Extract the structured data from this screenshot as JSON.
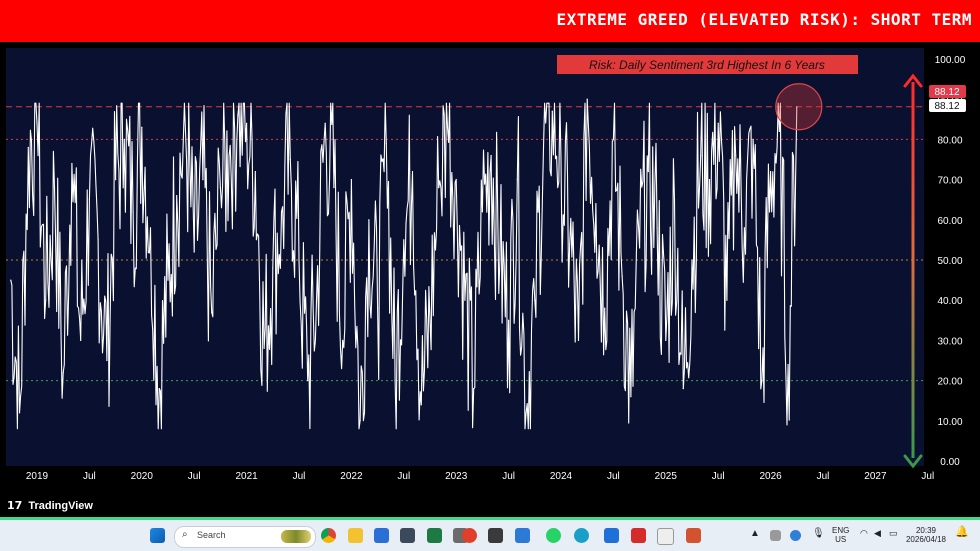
{
  "banner": {
    "title": "EXTREME GREED (ELEVATED RISK): SHORT TERM"
  },
  "annotation": {
    "text": "Risk: Daily Sentiment 3rd Highest In 6 Years"
  },
  "price_labels": {
    "current": "88.12",
    "reference": "88.12"
  },
  "branding": {
    "logo_text": "TradingView",
    "logo_mark": "17"
  },
  "taskbar": {
    "search_placeholder": "Search",
    "language": "ENG",
    "region": "US",
    "time": "20:39",
    "date": "2026/04/18"
  },
  "colors": {
    "banner": "#ff0000",
    "plot_background": "#0a1030",
    "series": "#ffffff",
    "high_dash": "#e03a3a",
    "mid_line": "#c0822a",
    "low_line": "#3f9f55",
    "arrow_top": "#ff2a2a",
    "arrow_bottom": "#3a9a4a"
  },
  "chart_data": {
    "type": "line",
    "title": "",
    "xlabel": "",
    "ylabel": "",
    "ylim": [
      0,
      100
    ],
    "y_ticks": [
      "100.00",
      "90.00",
      "80.00",
      "70.00",
      "60.00",
      "50.00",
      "40.00",
      "30.00",
      "20.00",
      "10.00",
      "0.00"
    ],
    "x_ticks": [
      "2019",
      "Jul",
      "2020",
      "Jul",
      "2021",
      "Jul",
      "2022",
      "Jul",
      "2023",
      "Jul",
      "2024",
      "Jul",
      "2025",
      "Jul",
      "2026",
      "Jul",
      "2027",
      "Jul"
    ],
    "reference_lines": [
      88.12,
      80,
      50,
      20
    ],
    "last_value": 88.12,
    "highlight": {
      "date": "2026-04-18",
      "value": 88.12
    },
    "series": [
      {
        "x": [
          "2018-10",
          "2018-11",
          "2018-12",
          "2019-01",
          "2019-02",
          "2019-03",
          "2019-04",
          "2019-05",
          "2019-06",
          "2019-07",
          "2019-08",
          "2019-09",
          "2019-10",
          "2019-11",
          "2019-12",
          "2020-01",
          "2020-02",
          "2020-03",
          "2020-04",
          "2020-05",
          "2020-06",
          "2020-07",
          "2020-08",
          "2020-09",
          "2020-10",
          "2020-11",
          "2020-12",
          "2021-01",
          "2021-02",
          "2021-03",
          "2021-04",
          "2021-05",
          "2021-06",
          "2021-07",
          "2021-08",
          "2021-09",
          "2021-10",
          "2021-11",
          "2021-12",
          "2022-01",
          "2022-02",
          "2022-03",
          "2022-04",
          "2022-05",
          "2022-06",
          "2022-07",
          "2022-08",
          "2022-09",
          "2022-10",
          "2022-11",
          "2022-12",
          "2023-01",
          "2023-02",
          "2023-03",
          "2023-04",
          "2023-05",
          "2023-06",
          "2023-07",
          "2023-08",
          "2023-09",
          "2023-10",
          "2023-11",
          "2023-12",
          "2024-01",
          "2024-02",
          "2024-03",
          "2024-04",
          "2024-05",
          "2024-06",
          "2024-07",
          "2024-08",
          "2024-09",
          "2024-10",
          "2024-11",
          "2024-12",
          "2025-01",
          "2025-02",
          "2025-03",
          "2025-04",
          "2025-05",
          "2025-06",
          "2025-07",
          "2025-08",
          "2025-09",
          "2025-10",
          "2025-11",
          "2025-12",
          "2026-01",
          "2026-02",
          "2026-03",
          "2026-04"
        ],
        "values": [
          45,
          12,
          78,
          84,
          40,
          68,
          22,
          74,
          30,
          65,
          55,
          25,
          70,
          80,
          62,
          83,
          58,
          18,
          45,
          66,
          82,
          52,
          70,
          37,
          68,
          76,
          86,
          84,
          72,
          28,
          48,
          62,
          75,
          50,
          20,
          40,
          84,
          68,
          30,
          70,
          10,
          60,
          38,
          79,
          20,
          55,
          72,
          14,
          35,
          68,
          83,
          70,
          40,
          18,
          62,
          76,
          50,
          35,
          70,
          12,
          40,
          78,
          87,
          75,
          54,
          30,
          90,
          64,
          38,
          80,
          46,
          16,
          53,
          72,
          58,
          30,
          65,
          18,
          50,
          76,
          70,
          84,
          40,
          76,
          58,
          80,
          20,
          72,
          82,
          24,
          88.12
        ]
      }
    ]
  }
}
